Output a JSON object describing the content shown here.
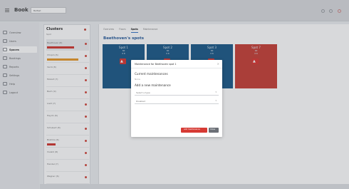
{
  "app": {
    "brand": "Book",
    "selector_value": "Belfast"
  },
  "leftnav": {
    "items": [
      {
        "label": "Overview",
        "icon": "dashboard-icon",
        "active": false
      },
      {
        "label": "Users",
        "icon": "users-icon",
        "active": false
      },
      {
        "label": "Spaces",
        "icon": "spaces-icon",
        "active": true
      },
      {
        "label": "Bookings",
        "icon": "calendar-icon",
        "active": false
      },
      {
        "label": "Reports",
        "icon": "report-icon",
        "active": false
      },
      {
        "label": "Settings",
        "icon": "gear-icon",
        "active": false
      },
      {
        "label": "Help",
        "icon": "help-icon",
        "active": false
      },
      {
        "label": "Logout",
        "icon": "logout-icon",
        "active": false
      }
    ]
  },
  "clusters": {
    "title": "Clusters",
    "subtitle": "Spot",
    "items": [
      {
        "label": "Beethoven (8)",
        "bar": "red",
        "bar_fraction": 0.8,
        "selected": true
      },
      {
        "label": "Chopin (6)",
        "bar": "amber",
        "bar_fraction": 0.7,
        "selected": false
      },
      {
        "label": "Verdi (8)",
        "bar": "",
        "selected": false
      },
      {
        "label": "Mozart (7)",
        "bar": "",
        "selected": false
      },
      {
        "label": "Bach (9)",
        "bar": "",
        "selected": false
      },
      {
        "label": "Liszt (7)",
        "bar": "",
        "selected": false
      },
      {
        "label": "Haydn (6)",
        "bar": "",
        "selected": false
      },
      {
        "label": "Schubert (8)",
        "bar": "",
        "selected": false
      },
      {
        "label": "Brahms (6)",
        "bar": "red",
        "bar_fraction": 0.3,
        "selected": false
      },
      {
        "label": "Vivaldi (8)",
        "bar": "",
        "selected": false
      },
      {
        "label": "Handel (7)",
        "bar": "",
        "selected": false
      },
      {
        "label": "Wagner (6)",
        "bar": "",
        "selected": false
      }
    ]
  },
  "main": {
    "tabs": [
      {
        "label": "Overview",
        "active": false
      },
      {
        "label": "Floors",
        "active": false
      },
      {
        "label": "Spots",
        "active": true
      },
      {
        "label": "Maintenance",
        "active": false
      }
    ],
    "spots_title": "Beethoven's spots",
    "spots": [
      {
        "title": "Spot 1",
        "color": "#1f5c8a",
        "line1": "SN",
        "line2": "8 B"
      },
      {
        "title": "Spot 2",
        "color": "#1f5c8a",
        "line1": "SN",
        "line2": "8 B"
      },
      {
        "title": "Spot 3",
        "color": "#1f5c8a",
        "line1": "SN",
        "line2": "8 B"
      },
      {
        "title": "Spot 7",
        "color": "#c7423a",
        "line1": "SN",
        "line2": "8 B"
      }
    ]
  },
  "modal": {
    "title": "Maintenance for Beethoven spot 1",
    "current_heading": "Current maintenances",
    "current_none": "None",
    "add_heading": "Add a new maintenance",
    "select_type_placeholder": "Select a type",
    "select_option_placeholder": "Disabled",
    "add_button": "Add maintenance",
    "close_button": "Close"
  },
  "colors": {
    "accent_red": "#d63a34",
    "spot_blue": "#1f5c8a",
    "title_blue": "#2b5f9e"
  }
}
